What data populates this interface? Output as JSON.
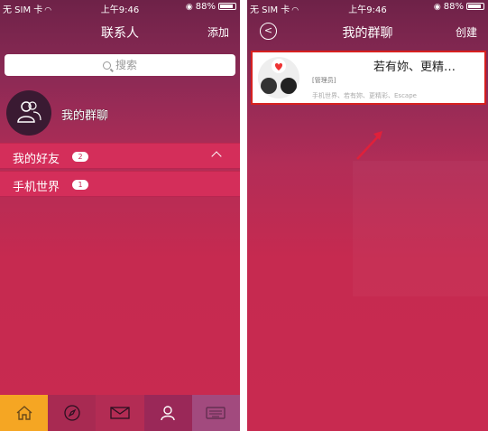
{
  "left_screen": {
    "status": {
      "carrier": "无 SIM 卡",
      "time": "上午9:46",
      "battery": "88%"
    },
    "nav": {
      "title": "联系人",
      "add_label": "添加"
    },
    "search": {
      "placeholder": "搜索"
    },
    "group_entry": {
      "label": "我的群聊"
    },
    "sections": [
      {
        "name": "我的好友",
        "count": "2"
      },
      {
        "name": "手机世界",
        "count": "1"
      }
    ],
    "tabbar": [
      {
        "icon": "home-icon"
      },
      {
        "icon": "compass-icon"
      },
      {
        "icon": "mail-icon"
      },
      {
        "icon": "contacts-icon"
      },
      {
        "icon": "keyboard-icon"
      }
    ]
  },
  "right_screen": {
    "status": {
      "carrier": "无 SIM 卡",
      "time": "上午9:46",
      "battery": "88%"
    },
    "nav": {
      "title": "我的群聊",
      "create_label": "创建"
    },
    "group": {
      "name": "若有妳、更精…",
      "role": "[管理员]",
      "members": "手机世界、若有妳、更精彩、Escape"
    }
  },
  "colors": {
    "accent_highlight": "#d62020",
    "home_tab": "#f5a623",
    "badge_text": "#c42a52"
  }
}
